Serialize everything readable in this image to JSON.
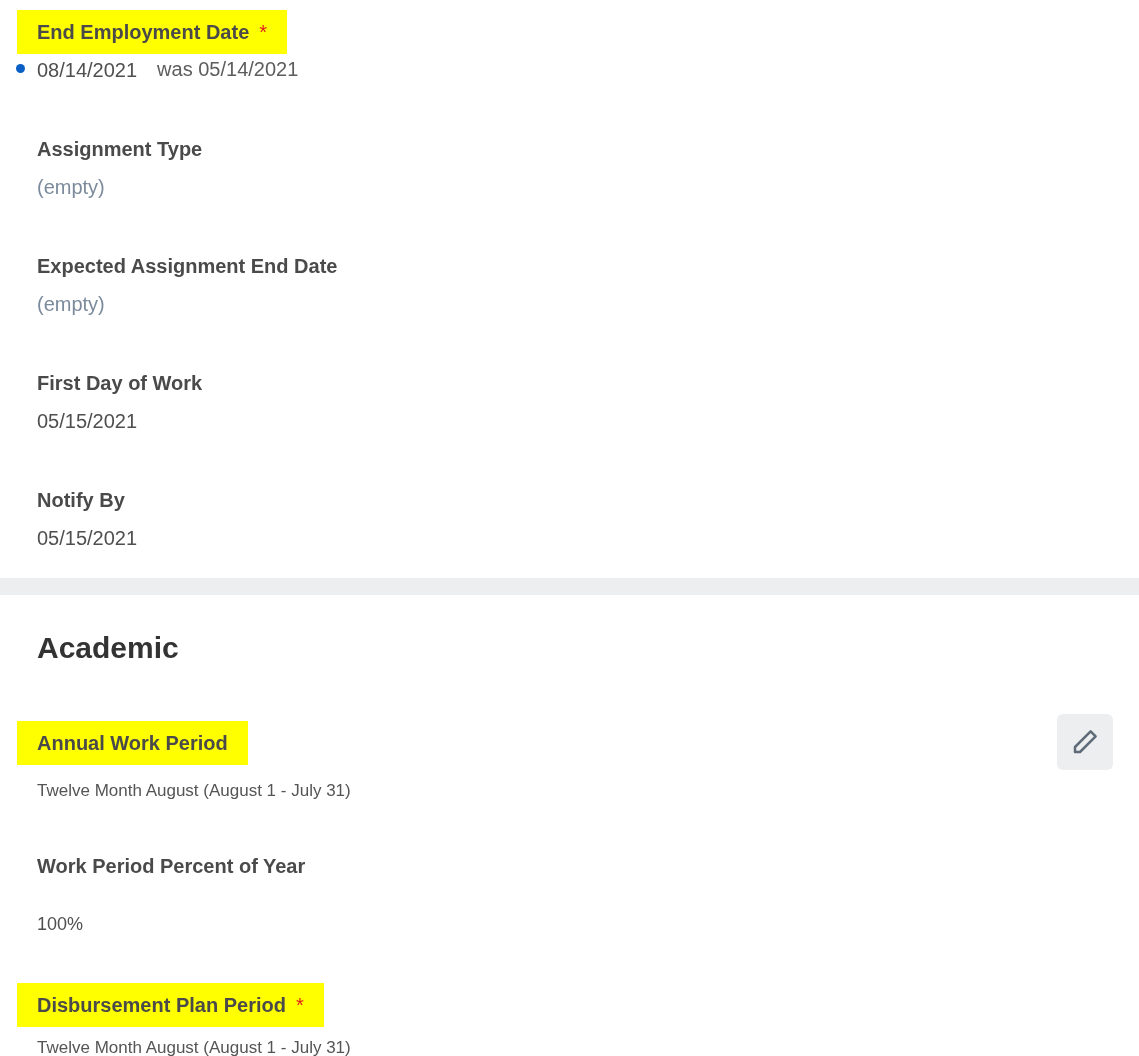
{
  "top_fields": [
    {
      "label": "End Employment Date",
      "highlighted": true,
      "required_mark": "*",
      "value": "08/14/2021",
      "kind": "changed",
      "previous": "was 05/14/2021"
    },
    {
      "label": "Assignment Type",
      "highlighted": false,
      "value": "(empty)",
      "kind": "empty"
    },
    {
      "label": "Expected Assignment End Date",
      "highlighted": false,
      "value": "(empty)",
      "kind": "empty"
    },
    {
      "label": "First Day of Work",
      "highlighted": false,
      "value": "05/15/2021",
      "kind": "plain"
    },
    {
      "label": "Notify By",
      "highlighted": false,
      "value": "05/15/2021",
      "kind": "plain"
    }
  ],
  "section": {
    "title": "Academic",
    "fields": [
      {
        "label": "Annual Work Period",
        "highlighted": true,
        "value": "Twelve Month August (August 1 - July 31)",
        "kind": "small",
        "editable": true
      },
      {
        "label": "Work Period Percent of Year",
        "highlighted": false,
        "value": "100%",
        "kind": "spaced",
        "editable": false
      },
      {
        "label": "Disbursement Plan Period",
        "highlighted": true,
        "required_mark": "*",
        "value": "Twelve Month August (August 1 - July 31)",
        "kind": "small",
        "editable": false
      }
    ]
  }
}
